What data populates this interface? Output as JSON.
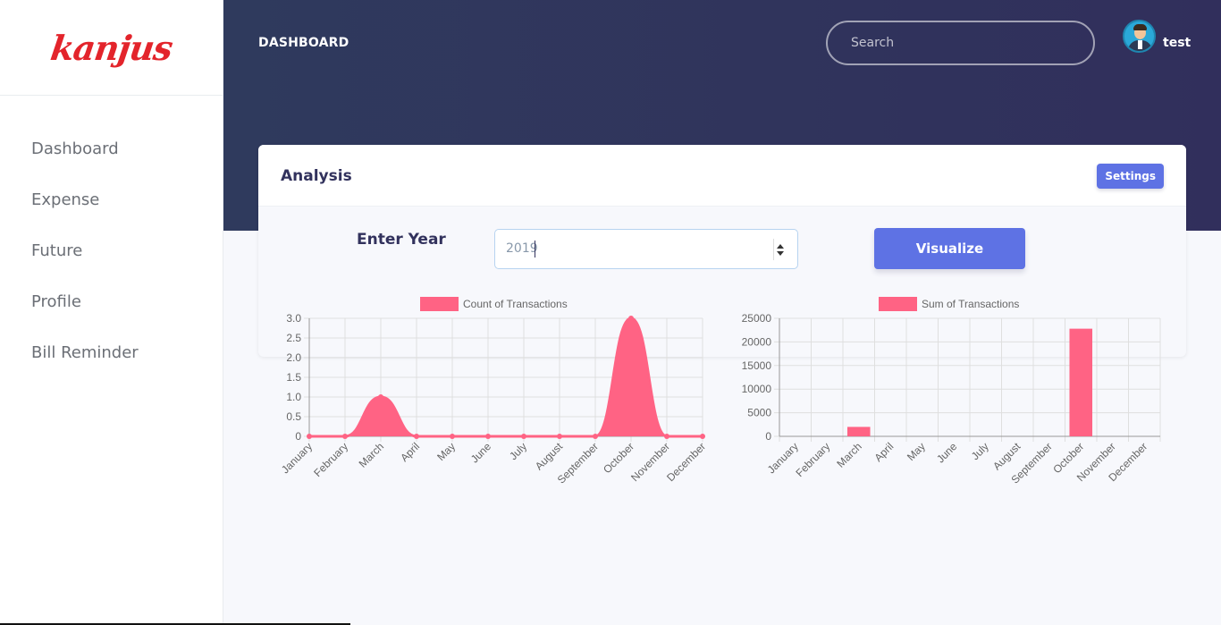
{
  "brand": {
    "logo_text": "kanjus"
  },
  "sidebar": {
    "items": [
      {
        "label": "Dashboard"
      },
      {
        "label": "Expense"
      },
      {
        "label": "Future"
      },
      {
        "label": "Profile"
      },
      {
        "label": "Bill Reminder"
      }
    ]
  },
  "header": {
    "title": "DASHBOARD",
    "search_placeholder": "Search",
    "username": "test"
  },
  "analysis": {
    "title": "Analysis",
    "settings_label": "Settings",
    "year_label": "Enter Year",
    "year_value": "2019",
    "visualize_label": "Visualize"
  },
  "colors": {
    "accent": "#5e72e4",
    "chart": "#ff6384",
    "header_bg": "#2f3a5d"
  },
  "chart_data": [
    {
      "type": "area",
      "legend": "Count of Transactions",
      "categories": [
        "January",
        "February",
        "March",
        "April",
        "May",
        "June",
        "July",
        "August",
        "September",
        "October",
        "November",
        "December"
      ],
      "values": [
        0,
        0,
        1,
        0,
        0,
        0,
        0,
        0,
        0,
        3,
        0,
        0
      ],
      "ylim": [
        0,
        3
      ],
      "yticks": [
        "3.0",
        "2.5",
        "2.0",
        "1.5",
        "1.0",
        "0.5",
        "0"
      ],
      "grid": true,
      "legend_position": "top"
    },
    {
      "type": "bar",
      "legend": "Sum of Transactions",
      "categories": [
        "January",
        "February",
        "March",
        "April",
        "May",
        "June",
        "July",
        "August",
        "September",
        "October",
        "November",
        "December"
      ],
      "values": [
        0,
        0,
        2000,
        0,
        0,
        0,
        0,
        0,
        0,
        22800,
        0,
        0
      ],
      "ylim": [
        0,
        25000
      ],
      "yticks": [
        "25000",
        "20000",
        "15000",
        "10000",
        "5000",
        "0"
      ],
      "grid": true,
      "legend_position": "top"
    }
  ]
}
